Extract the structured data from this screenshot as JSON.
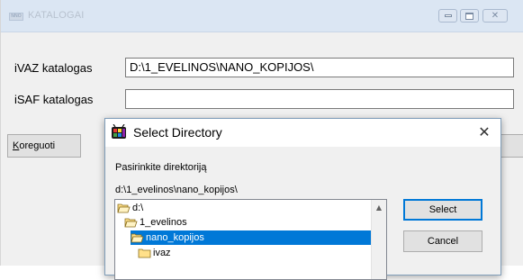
{
  "main_window": {
    "title": "KATALOGAI",
    "app_icon_text": "NNO",
    "fields": [
      {
        "label": "iVAZ katalogas",
        "value": "D:\\1_EVELINOS\\NANO_KOPIJOS\\"
      },
      {
        "label": "iSAF katalogas",
        "value": ""
      }
    ],
    "button": {
      "label_mnemonic": "K",
      "label_rest": "oreguoti"
    }
  },
  "dialog": {
    "title": "Select Directory",
    "prompt": "Pasirinkite direktoriją",
    "current_path": "d:\\1_evelinos\\nano_kopijos\\",
    "tree": [
      {
        "label": "d:\\",
        "icon": "open-folder-icon",
        "selected": false
      },
      {
        "label": "1_evelinos",
        "icon": "open-folder-icon",
        "selected": false
      },
      {
        "label": "nano_kopijos",
        "icon": "open-folder-icon",
        "selected": true
      },
      {
        "label": "ivaz",
        "icon": "folder-icon",
        "selected": false
      }
    ],
    "select_label": "Select",
    "cancel_label": "Cancel",
    "close_glyph": "✕"
  },
  "colors": {
    "selection": "#0078d7",
    "dialog_border": "#7f9db9"
  }
}
